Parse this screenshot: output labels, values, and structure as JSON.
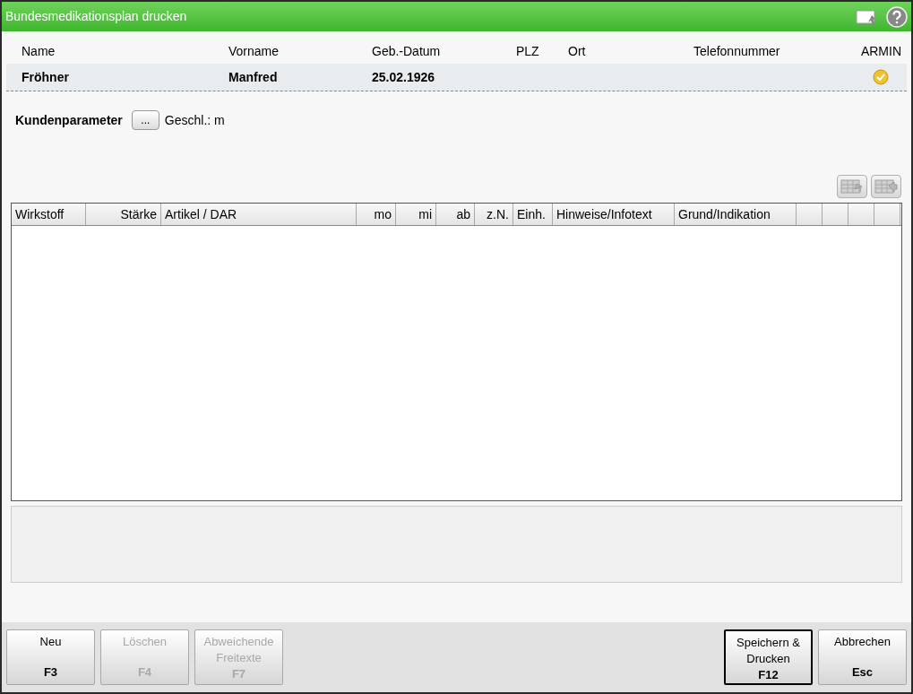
{
  "window": {
    "title": "Bundesmedikationsplan drucken"
  },
  "patient": {
    "columns": [
      "Name",
      "Vorname",
      "Geb.-Datum",
      "PLZ",
      "Ort",
      "Telefonnummer",
      "ARMIN"
    ],
    "row": {
      "name": "Fröhner",
      "vorname": "Manfred",
      "geburtsdatum": "25.02.1926"
    }
  },
  "kundenparameter": {
    "label": "Kundenparameter",
    "button": "...",
    "info": "Geschl.: m"
  },
  "table": {
    "columns": [
      {
        "label": "Wirkstoff",
        "kind": "text"
      },
      {
        "label": "Stärke",
        "kind": "number"
      },
      {
        "label": "Artikel / DAR",
        "kind": "text"
      },
      {
        "label": "mo",
        "kind": "number"
      },
      {
        "label": "mi",
        "kind": "number"
      },
      {
        "label": "ab",
        "kind": "number"
      },
      {
        "label": "z.N.",
        "kind": "number"
      },
      {
        "label": "Einh.",
        "kind": "text"
      },
      {
        "label": "Hinweise/Infotext",
        "kind": "text"
      },
      {
        "label": "Grund/Indikation",
        "kind": "text"
      }
    ]
  },
  "buttons": [
    {
      "label": "Neu",
      "key": "F3",
      "disabled": false,
      "default": false
    },
    {
      "label": "Löschen",
      "key": "F4",
      "disabled": true,
      "default": false
    },
    {
      "label": "Abweichende Freitexte",
      "key": "F7",
      "disabled": true,
      "default": false
    },
    {
      "label": "Speichern & Drucken",
      "key": "F12",
      "disabled": false,
      "default": true
    },
    {
      "label": "Abbrechen",
      "key": "Esc",
      "disabled": false,
      "default": false
    }
  ]
}
